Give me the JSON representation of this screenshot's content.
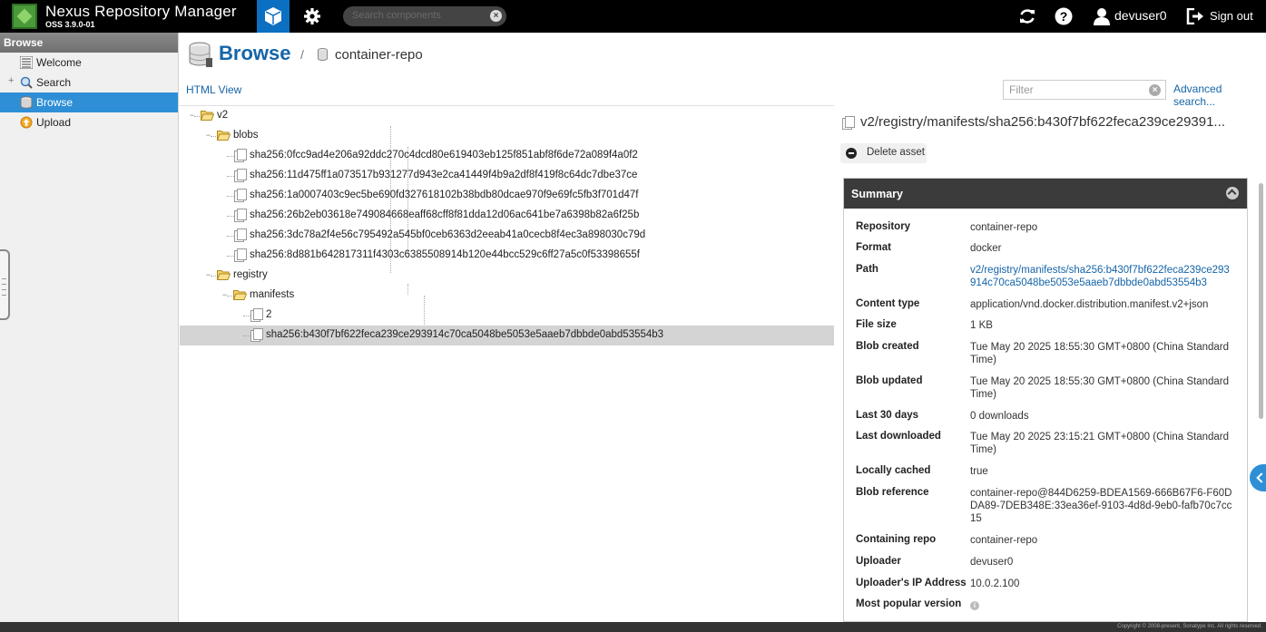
{
  "topbar": {
    "app_title": "Nexus Repository Manager",
    "app_version": "OSS 3.9.0-01",
    "search_placeholder": "Search components",
    "user": "devuser0",
    "signout_label": "Sign out"
  },
  "left": {
    "header": "Browse",
    "items": [
      {
        "label": "Welcome"
      },
      {
        "label": "Search"
      },
      {
        "label": "Browse"
      },
      {
        "label": "Upload"
      }
    ]
  },
  "main": {
    "breadcrumb_title": "Browse",
    "breadcrumb_sep": "/",
    "breadcrumb_repo": "container-repo",
    "html_view": "HTML View",
    "filter_placeholder": "Filter",
    "advanced_search": "Advanced search..."
  },
  "tree": {
    "nodes": [
      {
        "label": "v2"
      },
      {
        "label": "blobs"
      },
      {
        "label": "sha256:0fcc9ad4e206a92ddc270c4dcd80e619403eb125f851abf8f6de72a089f4a0f2"
      },
      {
        "label": "sha256:11d475ff1a073517b931277d943e2ca41449f4b9a2df8f419f8c64dc7dbe37ce"
      },
      {
        "label": "sha256:1a0007403c9ec5be690fd327618102b38bdb80dcae970f9e69fc5fb3f701d47f"
      },
      {
        "label": "sha256:26b2eb03618e749084668eaff68cff8f81dda12d06ac641be7a6398b82a6f25b"
      },
      {
        "label": "sha256:3dc78a2f4e56c795492a545bf0ceb6363d2eeab41a0cecb8f4ec3a898030c79d"
      },
      {
        "label": "sha256:8d881b642817311f4303c6385508914b120e44bcc529c6ff27a5c0f53398655f"
      },
      {
        "label": "registry"
      },
      {
        "label": "manifests"
      },
      {
        "label": "2"
      },
      {
        "label": "sha256:b430f7bf622feca239ce293914c70ca5048be5053e5aaeb7dbbde0abd53554b3"
      }
    ]
  },
  "details": {
    "asset_path": "v2/registry/manifests/sha256:b430f7bf622feca239ce29391...",
    "delete_label": "Delete asset",
    "summary_title": "Summary",
    "fields": [
      {
        "key": "Repository",
        "value": "container-repo"
      },
      {
        "key": "Format",
        "value": "docker"
      },
      {
        "key": "Path",
        "value": "v2/registry/manifests/sha256:b430f7bf622feca239ce293914c70ca5048be5053e5aaeb7dbbde0abd53554b3"
      },
      {
        "key": "Content type",
        "value": "application/vnd.docker.distribution.manifest.v2+json"
      },
      {
        "key": "File size",
        "value": "1 KB"
      },
      {
        "key": "Blob created",
        "value": "Tue May 20 2025 18:55:30 GMT+0800 (China Standard Time)"
      },
      {
        "key": "Blob updated",
        "value": "Tue May 20 2025 18:55:30 GMT+0800 (China Standard Time)"
      },
      {
        "key": "Last 30 days",
        "value": "0 downloads"
      },
      {
        "key": "Last downloaded",
        "value": "Tue May 20 2025 23:15:21 GMT+0800 (China Standard Time)"
      },
      {
        "key": "Locally cached",
        "value": "true"
      },
      {
        "key": "Blob reference",
        "value": "container-repo@844D6259-BDEA1569-666B67F6-F60DDA89-7DEB348E:33ea36ef-9103-4d8d-9eb0-fafb70c7cc15"
      },
      {
        "key": "Containing repo",
        "value": "container-repo"
      },
      {
        "key": "Uploader",
        "value": "devuser0"
      },
      {
        "key": "Uploader's IP Address",
        "value": "10.0.2.100"
      },
      {
        "key": "Most popular version",
        "value": ""
      }
    ]
  },
  "footer": {
    "copyright": "Copyright © 2008-present, Sonatype Inc. All rights reserved."
  },
  "colors": {
    "accent": "#0b6fc2",
    "selection": "#2f8fd6",
    "link": "#1565a8"
  }
}
